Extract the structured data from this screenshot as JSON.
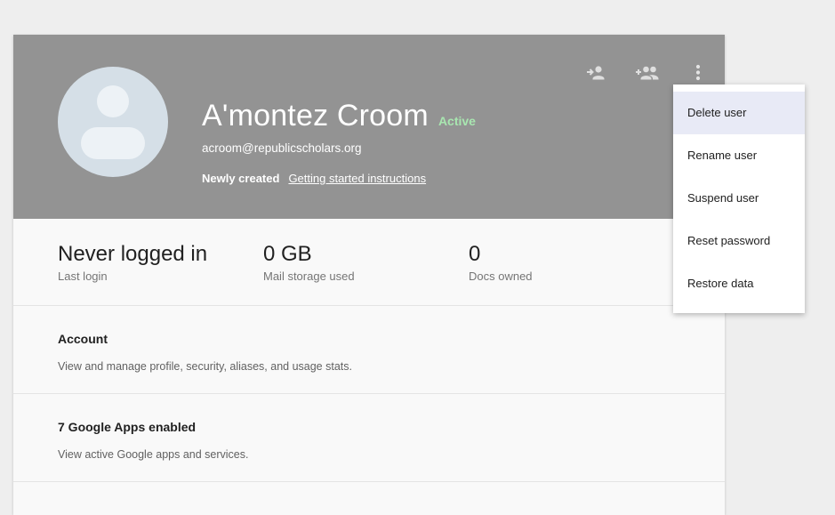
{
  "user": {
    "name": "A'montez Croom",
    "status": "Active",
    "email": "acroom@republicscholars.org",
    "badge": "Newly created",
    "link": "Getting started instructions"
  },
  "header_actions": [
    {
      "name": "assign-user-icon"
    },
    {
      "name": "add-to-group-icon"
    },
    {
      "name": "more-vert-icon"
    }
  ],
  "stats": [
    {
      "value": "Never logged in",
      "label": "Last login"
    },
    {
      "value": "0 GB",
      "label": "Mail storage used"
    },
    {
      "value": "0",
      "label": "Docs owned"
    }
  ],
  "sections": [
    {
      "title": "Account",
      "description": "View and manage profile, security, aliases, and usage stats."
    },
    {
      "title": "7 Google Apps enabled",
      "description": "View active Google apps and services."
    }
  ],
  "menu": {
    "items": [
      "Delete user",
      "Rename user",
      "Suspend user",
      "Reset password",
      "Restore data"
    ],
    "highlighted": "Delete user"
  },
  "colors": {
    "header_bg": "#939393",
    "status": "#a8e6b0",
    "menu_highlight": "#e8eaf6",
    "page_bg": "#eeeeee"
  }
}
